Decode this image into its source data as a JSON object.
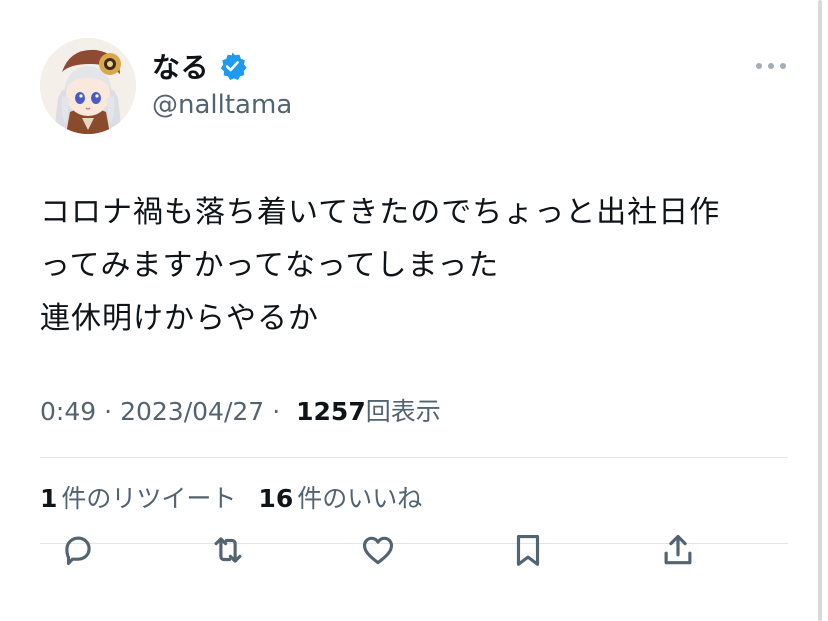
{
  "user": {
    "display_name": "なる",
    "handle": "@nalltama",
    "verified_icon": "verified-badge-icon",
    "verified_color": "#1d9bf0"
  },
  "tweet": {
    "text": "コロナ禍も落ち着いてきたのでちょっと出社日作\nってみますかってなってしまった\n連休明けからやるか",
    "time": "0:49",
    "date": "2023/04/27",
    "views_count": "1257",
    "views_label": "回表示",
    "separator": "·"
  },
  "stats": {
    "retweets_count": "1",
    "retweets_label": "件のリツイート",
    "likes_count": "16",
    "likes_label": "件のいいね"
  },
  "actions": [
    {
      "name": "reply",
      "icon": "reply-icon"
    },
    {
      "name": "retweet",
      "icon": "retweet-icon"
    },
    {
      "name": "like",
      "icon": "heart-icon"
    },
    {
      "name": "bookmark",
      "icon": "bookmark-icon"
    },
    {
      "name": "share",
      "icon": "share-icon"
    }
  ],
  "colors": {
    "text_primary": "#0f1419",
    "text_secondary": "#536471",
    "divider": "#e1e6ea"
  }
}
